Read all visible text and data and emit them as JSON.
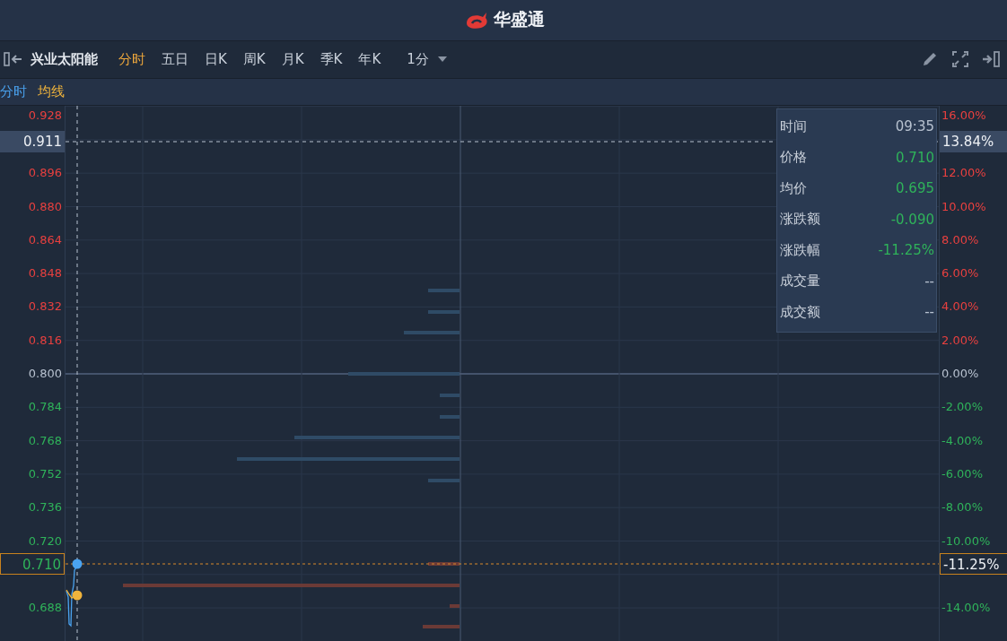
{
  "header": {
    "logo_text": "华盛通"
  },
  "toolbar": {
    "stock_name": "兴业太阳能",
    "tabs": [
      {
        "label": "分时",
        "selected": true
      },
      {
        "label": "五日",
        "selected": false
      },
      {
        "label": "日K",
        "selected": false
      },
      {
        "label": "周K",
        "selected": false
      },
      {
        "label": "月K",
        "selected": false
      },
      {
        "label": "季K",
        "selected": false
      },
      {
        "label": "年K",
        "selected": false
      }
    ],
    "interval": "1分"
  },
  "legend": [
    {
      "label": "分时",
      "color": "#4aa3f0"
    },
    {
      "label": "均线",
      "color": "#f0b43c"
    }
  ],
  "price_axis": [
    {
      "label": "0.928",
      "color": "#e8403f"
    },
    {
      "label": "0.896",
      "color": "#e8403f"
    },
    {
      "label": "0.880",
      "color": "#e8403f"
    },
    {
      "label": "0.864",
      "color": "#e8403f"
    },
    {
      "label": "0.848",
      "color": "#e8403f"
    },
    {
      "label": "0.832",
      "color": "#e8403f"
    },
    {
      "label": "0.816",
      "color": "#e8403f"
    },
    {
      "label": "0.800",
      "color": "#b8c2d0"
    },
    {
      "label": "0.784",
      "color": "#2fb35a"
    },
    {
      "label": "0.768",
      "color": "#2fb35a"
    },
    {
      "label": "0.752",
      "color": "#2fb35a"
    },
    {
      "label": "0.736",
      "color": "#2fb35a"
    },
    {
      "label": "0.720",
      "color": "#2fb35a"
    },
    {
      "label": "0.688",
      "color": "#2fb35a"
    }
  ],
  "percent_axis": [
    {
      "label": "16.00%",
      "color": "#e8403f"
    },
    {
      "label": "12.00%",
      "color": "#e8403f"
    },
    {
      "label": "10.00%",
      "color": "#e8403f"
    },
    {
      "label": "8.00%",
      "color": "#e8403f"
    },
    {
      "label": "6.00%",
      "color": "#e8403f"
    },
    {
      "label": "4.00%",
      "color": "#e8403f"
    },
    {
      "label": "2.00%",
      "color": "#e8403f"
    },
    {
      "label": "0.00%",
      "color": "#b8c2d0"
    },
    {
      "label": "-2.00%",
      "color": "#2fb35a"
    },
    {
      "label": "-4.00%",
      "color": "#2fb35a"
    },
    {
      "label": "-6.00%",
      "color": "#2fb35a"
    },
    {
      "label": "-8.00%",
      "color": "#2fb35a"
    },
    {
      "label": "-10.00%",
      "color": "#2fb35a"
    },
    {
      "label": "-14.00%",
      "color": "#2fb35a"
    }
  ],
  "cursor": {
    "price": "0.911",
    "percent": "13.84%"
  },
  "last": {
    "price": "0.710",
    "percent": "-11.25%"
  },
  "tooltip": [
    {
      "label": "时间",
      "value": "09:35",
      "color": "#b8c2d0"
    },
    {
      "label": "价格",
      "value": "0.710",
      "color": "#2fb35a"
    },
    {
      "label": "均价",
      "value": "0.695",
      "color": "#2fb35a"
    },
    {
      "label": "涨跌额",
      "value": "-0.090",
      "color": "#2fb35a"
    },
    {
      "label": "涨跌幅",
      "value": "-11.25%",
      "color": "#2fb35a"
    },
    {
      "label": "成交量",
      "value": "--",
      "color": "#b8c2d0"
    },
    {
      "label": "成交额",
      "value": "--",
      "color": "#b8c2d0"
    }
  ]
}
